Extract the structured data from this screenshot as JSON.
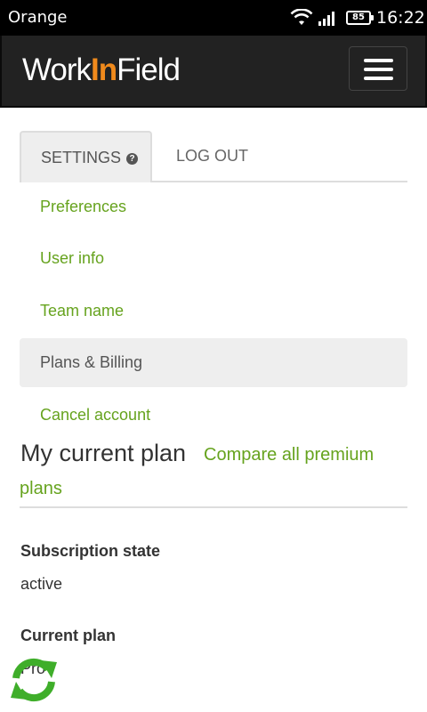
{
  "status_bar": {
    "carrier": "Orange",
    "battery": "85",
    "time": "16:22"
  },
  "navbar": {
    "brand_part1": "Work",
    "brand_accent": "In",
    "brand_part2": "Field",
    "menu_icon": "hamburger-icon"
  },
  "tabs": {
    "settings": "SETTINGS",
    "logout": "LOG OUT",
    "help_icon": "question-circle-icon"
  },
  "menu": {
    "items": [
      {
        "label": "Preferences"
      },
      {
        "label": "User info"
      },
      {
        "label": "Team name"
      },
      {
        "label": "Plans & Billing"
      },
      {
        "label": "Cancel account"
      }
    ]
  },
  "plan": {
    "title": "My current plan",
    "compare_link": "Compare all premium plans",
    "subscription_state_label": "Subscription state",
    "subscription_state_value": "active",
    "current_plan_label": "Current plan",
    "current_plan_value": "Pro"
  },
  "colors": {
    "link_green": "#66a31e",
    "brand_orange": "#f08a1c",
    "navbar_bg": "#222222"
  },
  "floating": {
    "refresh_icon": "refresh-icon"
  }
}
